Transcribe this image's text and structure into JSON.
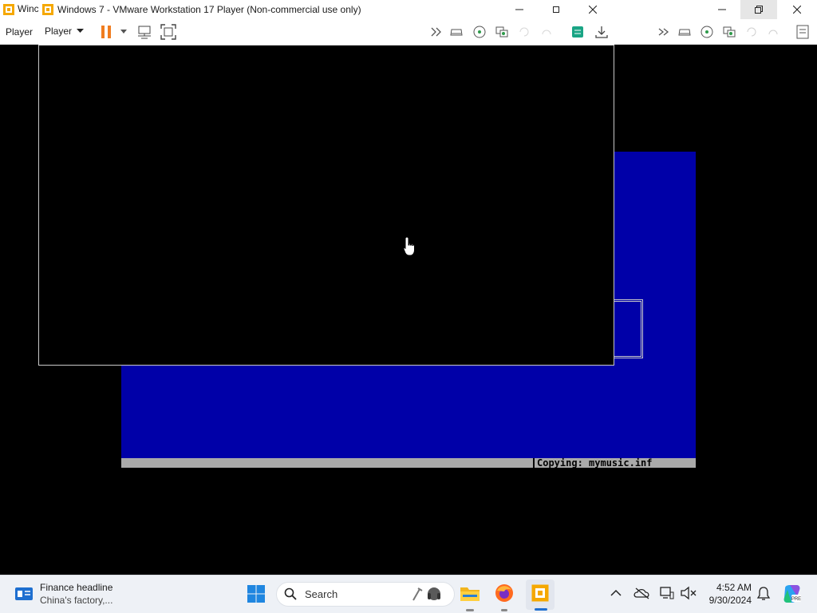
{
  "back_window": {
    "title_fragment": "Winc",
    "player_label": "Player"
  },
  "front_window": {
    "title": "Windows 7 - VMware Workstation 17 Player (Non-commercial use only)",
    "player_menu_label": "Player"
  },
  "guest": {
    "status_text": "Copying: mymusic.inf",
    "colors": {
      "setup_blue": "#0000a8",
      "status_gray": "#aaaaaa"
    }
  },
  "taskbar": {
    "news_title": "Finance headline",
    "news_subtitle": "China's factory,...",
    "search_label": "Search",
    "time": "4:52 AM",
    "date": "9/30/2024"
  }
}
